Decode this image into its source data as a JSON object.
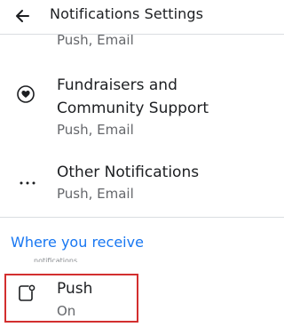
{
  "header": {
    "title": "Notifications Settings"
  },
  "rows": {
    "partial_top": {
      "secondary": "Push, Email"
    },
    "fundraisers": {
      "line1": "Fundraisers and",
      "line2": "Community Support",
      "secondary": "Push, Email",
      "icon": "heart-badge-icon"
    },
    "other": {
      "primary": "Other Notifications",
      "secondary": "Push, Email",
      "icon": "more-dots-icon"
    }
  },
  "section": {
    "title": "Where you receive",
    "subtitle": "notifications"
  },
  "push": {
    "label": "Push",
    "status": "On",
    "icon": "phone-notification-icon"
  },
  "colors": {
    "accent": "#1877f2",
    "highlight": "#d32f2f",
    "text": "#1c1e21",
    "secondary_text": "#65676b"
  }
}
